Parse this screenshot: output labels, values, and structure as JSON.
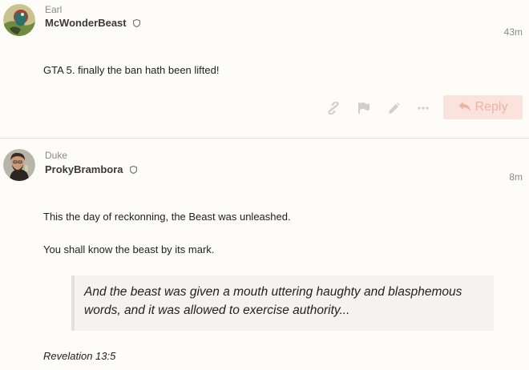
{
  "posts": [
    {
      "user_title": "Earl",
      "username": "McWonderBeast",
      "time_ago": "43m",
      "body": "GTA 5. finally the ban hath been lifted!",
      "actions": {
        "reply_label": "Reply"
      }
    },
    {
      "user_title": "Duke",
      "username": "ProkyBrambora",
      "time_ago": "8m",
      "paragraphs": [
        "This the day of reckonning, the Beast was unleashed.",
        "You shall know the beast by its mark."
      ],
      "quote": "And the beast was given a mouth uttering haughty and blasphemous words, and it was allowed to exercise authority...",
      "citation": "Revelation 13:5"
    }
  ],
  "colors": {
    "reply_bg": "#fbe3dd",
    "reply_text": "#f0b1a3",
    "action_icon": "#cfcfcf",
    "quote_bg": "#f4f3f1"
  },
  "icons": [
    "shield-icon",
    "link-icon",
    "flag-icon",
    "pencil-icon",
    "more-icon",
    "reply-arrow-icon"
  ]
}
